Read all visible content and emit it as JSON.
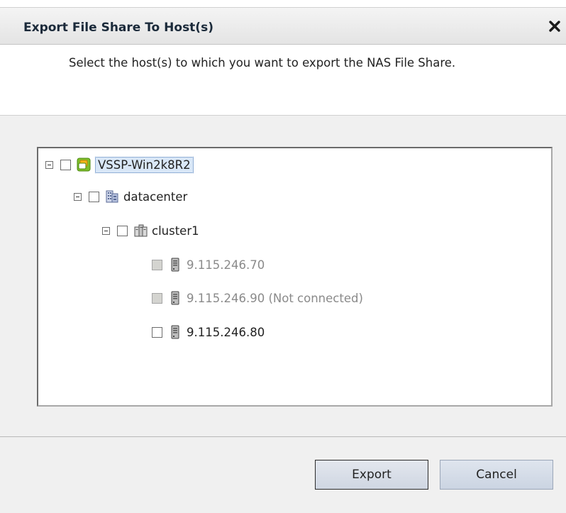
{
  "dialog": {
    "title": "Export File Share To Host(s)",
    "close_symbol": "✖",
    "instructions": "Select the host(s) to which you want to export the NAS File Share."
  },
  "tree": {
    "root": {
      "label": "VSSP-Win2k8R2",
      "icon": "vcenter-icon",
      "expanded": true,
      "checked": false,
      "selected": true
    },
    "datacenter": {
      "label": "datacenter",
      "icon": "datacenter-icon",
      "expanded": true,
      "checked": false
    },
    "cluster": {
      "label": "cluster1",
      "icon": "cluster-icon",
      "expanded": true,
      "checked": false
    },
    "hosts": [
      {
        "label": "9.115.246.70",
        "icon": "server-icon",
        "enabled": false,
        "checked": false
      },
      {
        "label": "9.115.246.90 (Not connected)",
        "icon": "server-icon",
        "enabled": false,
        "checked": false
      },
      {
        "label": "9.115.246.80",
        "icon": "server-icon",
        "enabled": true,
        "checked": false
      }
    ]
  },
  "buttons": {
    "export_label": "Export",
    "cancel_label": "Cancel"
  },
  "colors": {
    "title_text": "#1b2a3a",
    "selection_bg": "#d9e7f7",
    "button_bg": "#d6dde8",
    "disabled_text": "#8a8a8a"
  }
}
